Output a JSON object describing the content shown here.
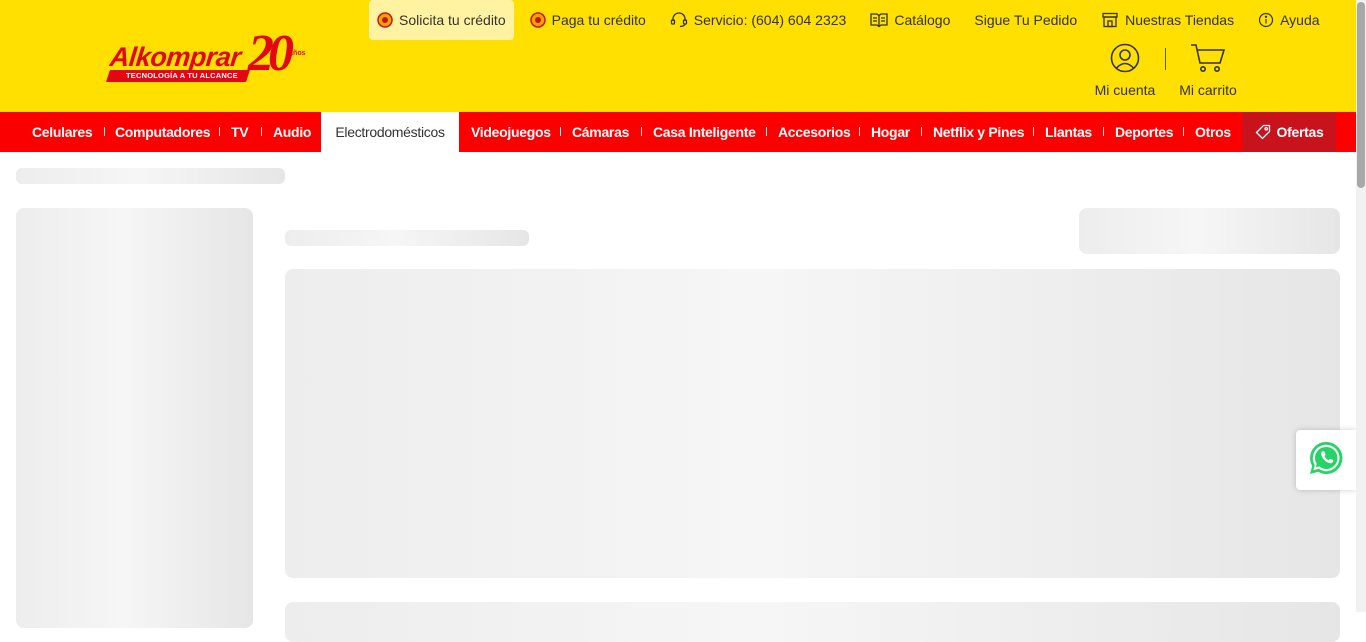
{
  "brand": {
    "name": "Alkomprar",
    "tagline": "TECNOLOGÍA A TU ALCANCE",
    "anniversary_number": "20",
    "anniversary_label": "Años"
  },
  "topnav": {
    "credit": "Solicita tu crédito",
    "pay_credit": "Paga tu crédito",
    "service": "Servicio: (604) 604 2323",
    "catalog": "Catálogo",
    "track_order": "Sigue Tu Pedido",
    "stores": "Nuestras Tiendas",
    "help": "Ayuda"
  },
  "account": {
    "label": "Mi cuenta"
  },
  "cart": {
    "label": "Mi carrito"
  },
  "categories": [
    "Celulares",
    "Computadores",
    "TV",
    "Audio",
    "Electrodomésticos",
    "Videojuegos",
    "Cámaras",
    "Casa Inteligente",
    "Accesorios",
    "Hogar",
    "Netflix y Pines",
    "Llantas",
    "Deportes",
    "Otros",
    "Ofertas"
  ],
  "active_category": "Electrodomésticos",
  "colors": {
    "header_yellow": "#ffe000",
    "category_red": "#fb0000",
    "offers_red": "#c8131c",
    "whatsapp_green": "#25d366"
  },
  "icons": {
    "credit": "credit-badge-icon",
    "pay_credit": "pay-credit-icon",
    "service": "headset-icon",
    "catalog": "catalog-book-icon",
    "stores": "store-icon",
    "help": "info-icon",
    "account": "user-icon",
    "cart": "cart-icon",
    "offers": "tag-icon",
    "whatsapp": "whatsapp-icon"
  }
}
